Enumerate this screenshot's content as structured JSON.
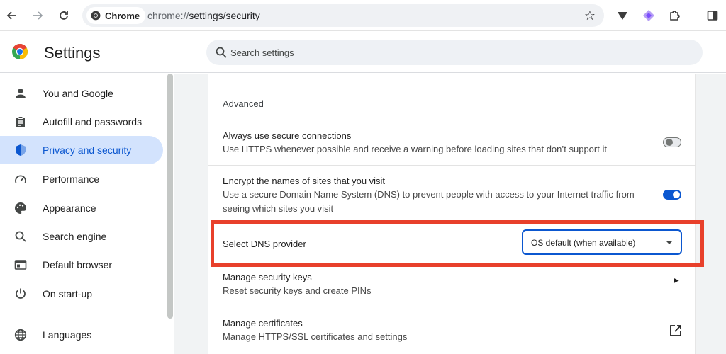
{
  "browser": {
    "chip_label": "Chrome",
    "url_host": "chrome://",
    "url_path": "settings/security"
  },
  "header": {
    "title": "Settings",
    "search_placeholder": "Search settings"
  },
  "sidebar": {
    "items": [
      {
        "label": "You and Google",
        "icon": "person-icon",
        "active": false
      },
      {
        "label": "Autofill and passwords",
        "icon": "clipboard-icon",
        "active": false
      },
      {
        "label": "Privacy and security",
        "icon": "shield-icon",
        "active": true
      },
      {
        "label": "Performance",
        "icon": "speedometer-icon",
        "active": false
      },
      {
        "label": "Appearance",
        "icon": "palette-icon",
        "active": false
      },
      {
        "label": "Search engine",
        "icon": "search-icon",
        "active": false
      },
      {
        "label": "Default browser",
        "icon": "browser-window-icon",
        "active": false
      },
      {
        "label": "On start-up",
        "icon": "power-icon",
        "active": false
      },
      {
        "label": "Languages",
        "icon": "globe-icon",
        "active": false
      }
    ]
  },
  "main": {
    "section_title": "Advanced",
    "rows": {
      "https": {
        "title": "Always use secure connections",
        "desc": "Use HTTPS whenever possible and receive a warning before loading sites that don’t support it",
        "toggle": "off"
      },
      "dns": {
        "title": "Encrypt the names of sites that you visit",
        "desc": "Use a secure Domain Name System (DNS) to prevent people with access to your Internet traffic from seeing which sites you visit",
        "toggle": "on"
      },
      "dns_provider": {
        "title": "Select DNS provider",
        "selected": "OS default (when available)"
      },
      "security_keys": {
        "title": "Manage security keys",
        "desc": "Reset security keys and create PINs"
      },
      "certificates": {
        "title": "Manage certificates",
        "desc": "Manage HTTPS/SSL certificates and settings"
      }
    }
  },
  "colors": {
    "accent": "#0b57d0",
    "active_nav_bg": "#d3e3fd",
    "highlight_red": "#e8402b"
  }
}
